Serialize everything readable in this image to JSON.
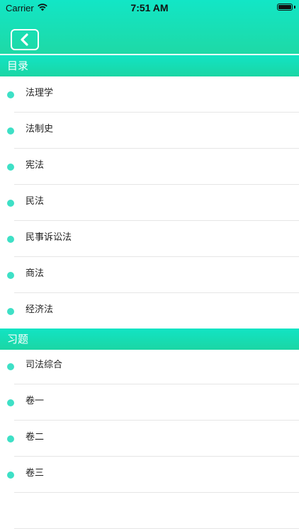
{
  "status_bar": {
    "carrier": "Carrier",
    "time": "7:51 AM",
    "battery_level": 1.0
  },
  "nav": {
    "back_icon": "chevron-left-icon"
  },
  "colors": {
    "header_top": "#12e6c6",
    "header_bottom": "#1ed9a6",
    "dot": "#3ee0c6",
    "separator": "#e6e6e6"
  },
  "sections": [
    {
      "title": "目录",
      "items": [
        "法理学",
        "法制史",
        "宪法",
        "民法",
        "民事诉讼法",
        "商法",
        "经济法"
      ]
    },
    {
      "title": "习题",
      "items": [
        "司法综合",
        "卷一",
        "卷二",
        "卷三",
        ""
      ]
    }
  ]
}
